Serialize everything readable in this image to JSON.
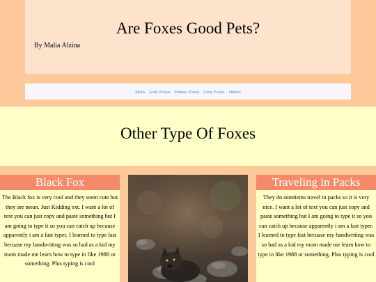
{
  "header": {
    "title": "Are Foxes Good Pets?",
    "byline": "By Malia Alzina"
  },
  "nav": {
    "items": [
      "Main",
      "Artic Foxes",
      "Fennec Foxes",
      "Grey Foxes",
      "Others"
    ]
  },
  "section": {
    "title": "Other Type Of Foxes"
  },
  "left_card": {
    "title": "Black Fox",
    "text": "The Black fox is very cool and they seem cute but they are mean. Just Kidding ext. I want a lot of text you can just copy and paste something but I am going to type it so you can catch up because apparently i am a fast typer. I learned to type fast becuase my handwriting was so bad as a kid my mom made me learn how to type in like 1988 or something. Plus typing is cool"
  },
  "right_card": {
    "title": "Traveling in Packs",
    "text": "They do somtiems travel in packs so it is very nice. I want a lot of text you can just copy and paste something but I am going to type it so you can catch up because apparently i am a fast typer. I learned to type fast becuase my handwriting was so bad as a kid my mom made me learn how to type in like 1988 or something. Plus typing is cool"
  },
  "colors": {
    "page_bg": "#fdc89a",
    "header_bg": "#fde2cc",
    "band_bg": "#ffffc8",
    "card_title_bg": "#f58a6a",
    "link": "#3d7fd6"
  },
  "photo": {
    "icon": "fox-photo"
  }
}
